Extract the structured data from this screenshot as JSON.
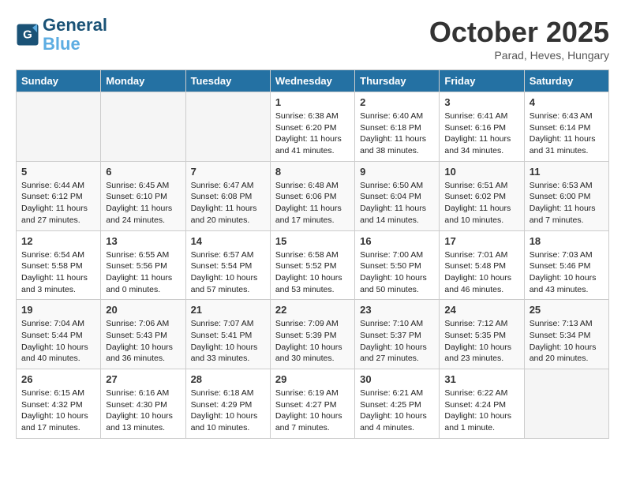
{
  "header": {
    "logo_line1": "General",
    "logo_line2": "Blue",
    "month": "October 2025",
    "location": "Parad, Heves, Hungary"
  },
  "days_of_week": [
    "Sunday",
    "Monday",
    "Tuesday",
    "Wednesday",
    "Thursday",
    "Friday",
    "Saturday"
  ],
  "weeks": [
    [
      {
        "day": "",
        "text": ""
      },
      {
        "day": "",
        "text": ""
      },
      {
        "day": "",
        "text": ""
      },
      {
        "day": "1",
        "text": "Sunrise: 6:38 AM\nSunset: 6:20 PM\nDaylight: 11 hours\nand 41 minutes."
      },
      {
        "day": "2",
        "text": "Sunrise: 6:40 AM\nSunset: 6:18 PM\nDaylight: 11 hours\nand 38 minutes."
      },
      {
        "day": "3",
        "text": "Sunrise: 6:41 AM\nSunset: 6:16 PM\nDaylight: 11 hours\nand 34 minutes."
      },
      {
        "day": "4",
        "text": "Sunrise: 6:43 AM\nSunset: 6:14 PM\nDaylight: 11 hours\nand 31 minutes."
      }
    ],
    [
      {
        "day": "5",
        "text": "Sunrise: 6:44 AM\nSunset: 6:12 PM\nDaylight: 11 hours\nand 27 minutes."
      },
      {
        "day": "6",
        "text": "Sunrise: 6:45 AM\nSunset: 6:10 PM\nDaylight: 11 hours\nand 24 minutes."
      },
      {
        "day": "7",
        "text": "Sunrise: 6:47 AM\nSunset: 6:08 PM\nDaylight: 11 hours\nand 20 minutes."
      },
      {
        "day": "8",
        "text": "Sunrise: 6:48 AM\nSunset: 6:06 PM\nDaylight: 11 hours\nand 17 minutes."
      },
      {
        "day": "9",
        "text": "Sunrise: 6:50 AM\nSunset: 6:04 PM\nDaylight: 11 hours\nand 14 minutes."
      },
      {
        "day": "10",
        "text": "Sunrise: 6:51 AM\nSunset: 6:02 PM\nDaylight: 11 hours\nand 10 minutes."
      },
      {
        "day": "11",
        "text": "Sunrise: 6:53 AM\nSunset: 6:00 PM\nDaylight: 11 hours\nand 7 minutes."
      }
    ],
    [
      {
        "day": "12",
        "text": "Sunrise: 6:54 AM\nSunset: 5:58 PM\nDaylight: 11 hours\nand 3 minutes."
      },
      {
        "day": "13",
        "text": "Sunrise: 6:55 AM\nSunset: 5:56 PM\nDaylight: 11 hours\nand 0 minutes."
      },
      {
        "day": "14",
        "text": "Sunrise: 6:57 AM\nSunset: 5:54 PM\nDaylight: 10 hours\nand 57 minutes."
      },
      {
        "day": "15",
        "text": "Sunrise: 6:58 AM\nSunset: 5:52 PM\nDaylight: 10 hours\nand 53 minutes."
      },
      {
        "day": "16",
        "text": "Sunrise: 7:00 AM\nSunset: 5:50 PM\nDaylight: 10 hours\nand 50 minutes."
      },
      {
        "day": "17",
        "text": "Sunrise: 7:01 AM\nSunset: 5:48 PM\nDaylight: 10 hours\nand 46 minutes."
      },
      {
        "day": "18",
        "text": "Sunrise: 7:03 AM\nSunset: 5:46 PM\nDaylight: 10 hours\nand 43 minutes."
      }
    ],
    [
      {
        "day": "19",
        "text": "Sunrise: 7:04 AM\nSunset: 5:44 PM\nDaylight: 10 hours\nand 40 minutes."
      },
      {
        "day": "20",
        "text": "Sunrise: 7:06 AM\nSunset: 5:43 PM\nDaylight: 10 hours\nand 36 minutes."
      },
      {
        "day": "21",
        "text": "Sunrise: 7:07 AM\nSunset: 5:41 PM\nDaylight: 10 hours\nand 33 minutes."
      },
      {
        "day": "22",
        "text": "Sunrise: 7:09 AM\nSunset: 5:39 PM\nDaylight: 10 hours\nand 30 minutes."
      },
      {
        "day": "23",
        "text": "Sunrise: 7:10 AM\nSunset: 5:37 PM\nDaylight: 10 hours\nand 27 minutes."
      },
      {
        "day": "24",
        "text": "Sunrise: 7:12 AM\nSunset: 5:35 PM\nDaylight: 10 hours\nand 23 minutes."
      },
      {
        "day": "25",
        "text": "Sunrise: 7:13 AM\nSunset: 5:34 PM\nDaylight: 10 hours\nand 20 minutes."
      }
    ],
    [
      {
        "day": "26",
        "text": "Sunrise: 6:15 AM\nSunset: 4:32 PM\nDaylight: 10 hours\nand 17 minutes."
      },
      {
        "day": "27",
        "text": "Sunrise: 6:16 AM\nSunset: 4:30 PM\nDaylight: 10 hours\nand 13 minutes."
      },
      {
        "day": "28",
        "text": "Sunrise: 6:18 AM\nSunset: 4:29 PM\nDaylight: 10 hours\nand 10 minutes."
      },
      {
        "day": "29",
        "text": "Sunrise: 6:19 AM\nSunset: 4:27 PM\nDaylight: 10 hours\nand 7 minutes."
      },
      {
        "day": "30",
        "text": "Sunrise: 6:21 AM\nSunset: 4:25 PM\nDaylight: 10 hours\nand 4 minutes."
      },
      {
        "day": "31",
        "text": "Sunrise: 6:22 AM\nSunset: 4:24 PM\nDaylight: 10 hours\nand 1 minute."
      },
      {
        "day": "",
        "text": ""
      }
    ]
  ]
}
